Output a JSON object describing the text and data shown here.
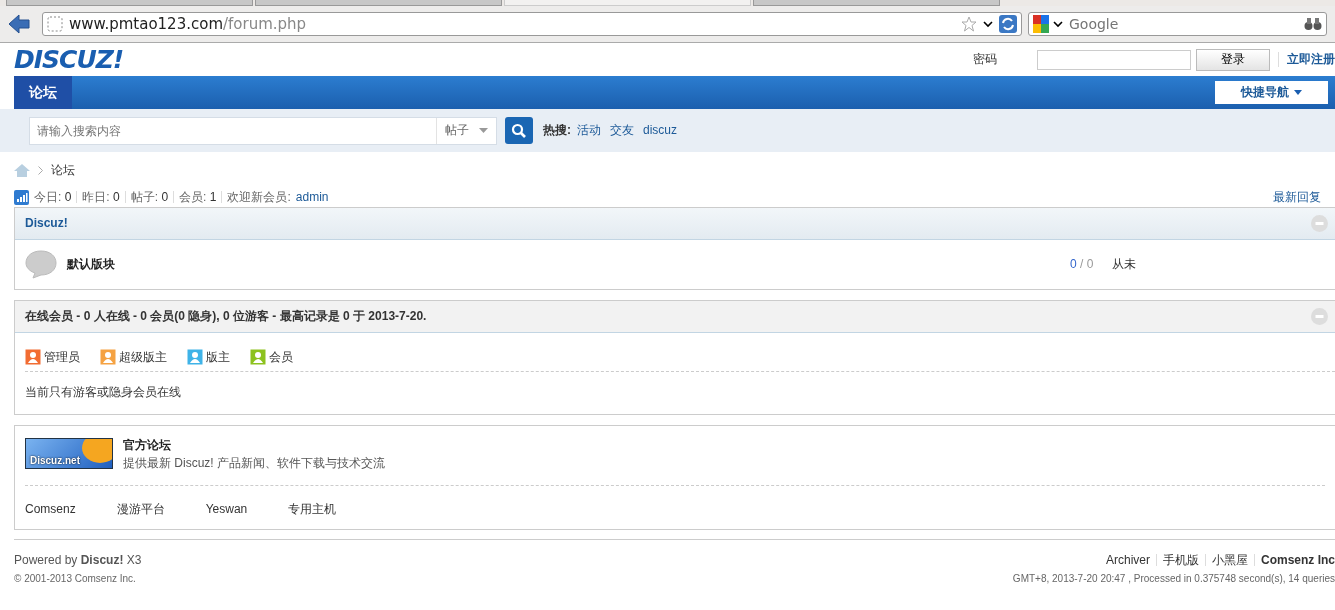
{
  "browser": {
    "tabs": [
      {
        "selected": false
      },
      {
        "selected": false
      },
      {
        "selected": true
      },
      {
        "selected": false
      }
    ],
    "url_host": "www.pmtao123.com",
    "url_path": "/forum.php",
    "search_placeholder": "Google"
  },
  "header": {
    "logo": "DISCUZ!",
    "password_label": "密码",
    "login_button": "登录",
    "register_link": "立即注册"
  },
  "nav": {
    "items": [
      {
        "label": "论坛",
        "selected": true
      }
    ],
    "quick_nav": "快捷导航"
  },
  "search": {
    "placeholder": "请输入搜索内容",
    "type": "帖子",
    "hot_label": "热搜:",
    "hot": [
      "活动",
      "交友",
      "discuz"
    ]
  },
  "breadcrumb": [
    "论坛"
  ],
  "stats": [
    {
      "label": "今日:",
      "value": "0"
    },
    {
      "label": "昨日:",
      "value": "0"
    },
    {
      "label": "帖子:",
      "value": "0"
    },
    {
      "label": "会员:",
      "value": "1"
    }
  ],
  "welcome": {
    "label": "欢迎新会员:",
    "user": "admin"
  },
  "latest_replies": "最新回复",
  "category": {
    "title": "Discuz!",
    "forums": [
      {
        "name": "默认版块",
        "threads": "0",
        "posts": "/ 0",
        "last": "从未"
      }
    ]
  },
  "online": {
    "title": "在线会员 - 0 人在线 - 0 会员(0 隐身), 0 位游客 - 最高记录是 0 于 2013-7-20.",
    "legend": [
      {
        "label": "管理员",
        "color": "#f26c32"
      },
      {
        "label": "超级版主",
        "color": "#f5a242"
      },
      {
        "label": "版主",
        "color": "#3fb3e8"
      },
      {
        "label": "会员",
        "color": "#8dc21f"
      }
    ],
    "note": "当前只有游客或隐身会员在线"
  },
  "links": {
    "title": "官方论坛",
    "desc": "提供最新 Discuz! 产品新闻、软件下载与技术交流",
    "banner": "Discuz.net",
    "items": [
      "Comsenz",
      "漫游平台",
      "Yeswan",
      "专用主机"
    ]
  },
  "footer": {
    "powered": "Powered by **Discuz!** X3",
    "copyright": "© 2001-2013 Comsenz Inc.",
    "links": [
      {
        "label": "Archiver",
        "bold": false
      },
      {
        "label": "手机版",
        "bold": false
      },
      {
        "label": "小黑屋",
        "bold": false
      },
      {
        "label": "Comsenz Inc",
        "bold": true
      }
    ],
    "meta": "GMT+8, 2013-7-20 20:47 , Processed in 0.375748 second(s), 14 queries"
  }
}
